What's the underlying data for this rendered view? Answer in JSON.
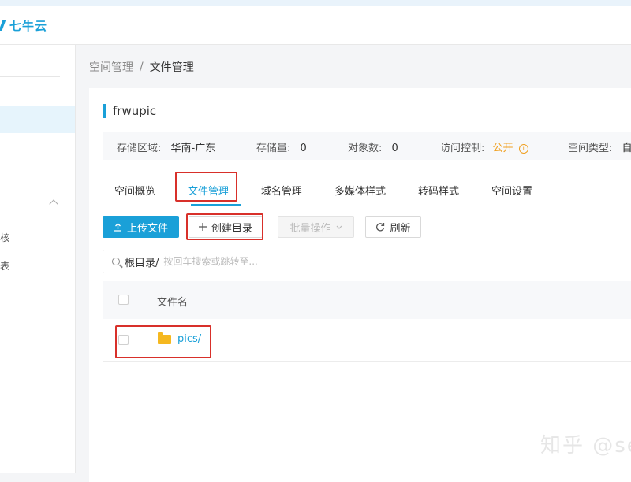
{
  "app": {
    "logo_text": "七牛云"
  },
  "sidebar": {
    "items": [
      "核",
      "表"
    ]
  },
  "breadcrumb": {
    "parent": "空间管理",
    "separator": "/",
    "current": "文件管理"
  },
  "bucket": {
    "name": "frwupic",
    "info": [
      {
        "label": "存储区域:",
        "value": "华南-广东"
      },
      {
        "label": "存储量:",
        "value": "0"
      },
      {
        "label": "对象数:",
        "value": "0"
      },
      {
        "label": "访问控制:",
        "value": "公开"
      },
      {
        "label": "空间类型:",
        "value": "自"
      }
    ],
    "public_info_glyph": "i"
  },
  "tabs": [
    "空间概览",
    "文件管理",
    "域名管理",
    "多媒体样式",
    "转码样式",
    "空间设置"
  ],
  "active_tab": "文件管理",
  "toolbar": {
    "upload_label": "上传文件",
    "create_dir_label": "创建目录",
    "batch_label": "批量操作",
    "refresh_label": "刷新"
  },
  "search": {
    "prefix": "根目录/",
    "placeholder": "按回车搜索或跳转至..."
  },
  "table": {
    "column_header": "文件名",
    "rows": [
      {
        "name": "pics/",
        "type": "folder"
      }
    ]
  },
  "watermark": "知乎 @se",
  "colors": {
    "accent": "#1aa0d8",
    "highlight": "#d8302a",
    "public": "#f0a020",
    "folder": "#f5b820"
  },
  "icons": [
    "upload-icon",
    "plus-icon",
    "chevron-down-icon",
    "refresh-icon",
    "search-icon",
    "folder-icon",
    "info-icon"
  ]
}
